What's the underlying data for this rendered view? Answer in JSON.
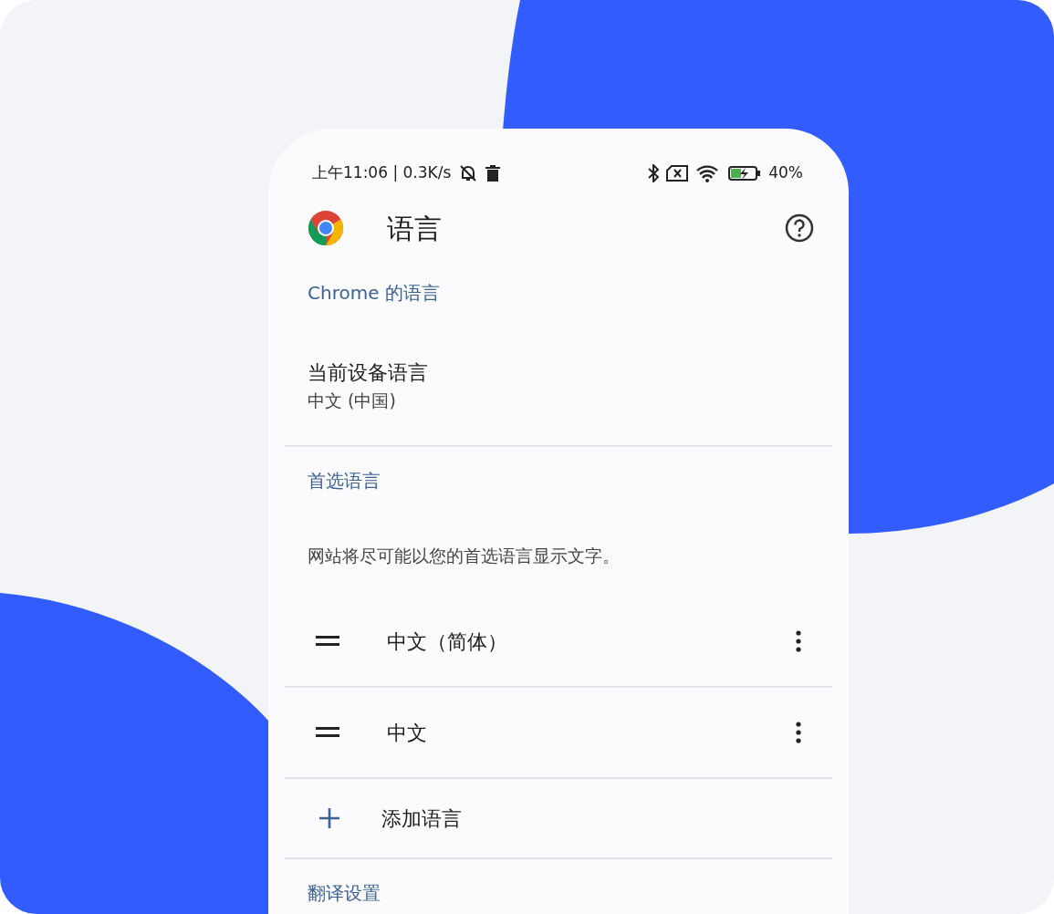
{
  "status_bar": {
    "time": "上午11:06 | 0.3K/s",
    "battery": "40%"
  },
  "toolbar": {
    "title": "语言"
  },
  "sections": [
    {
      "kind": "header",
      "text": "Chrome 的语言"
    },
    {
      "kind": "setting",
      "title": "当前设备语言",
      "subtitle": "中文 (中国)"
    },
    {
      "kind": "divider"
    },
    {
      "kind": "header",
      "text": "首选语言"
    },
    {
      "kind": "description",
      "text": "网站将尽可能以您的首选语言显示文字。"
    },
    {
      "kind": "language",
      "text": "中文（简体）"
    },
    {
      "kind": "divider"
    },
    {
      "kind": "language",
      "text": "中文"
    },
    {
      "kind": "divider"
    },
    {
      "kind": "add",
      "text": "添加语言"
    },
    {
      "kind": "divider"
    },
    {
      "kind": "header",
      "text": "翻译设置"
    }
  ]
}
